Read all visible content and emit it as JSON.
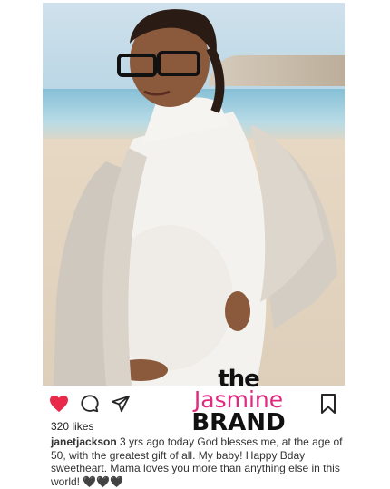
{
  "post": {
    "likes": "320 likes",
    "username": "janetjackson",
    "caption": " 3 yrs ago today God blesses me, at the age of 50, with the greatest gift of all. My baby! Happy Bday sweetheart. Mama loves you more than anything else in this world! 🖤🖤🖤"
  },
  "watermark": {
    "line1": "the",
    "line2": "Jasmine",
    "line3": "BRAND"
  },
  "icons": {
    "like": "heart-icon",
    "comment": "comment-icon",
    "share": "share-icon",
    "save": "bookmark-icon"
  },
  "colors": {
    "like": "#e8294a",
    "watermark_accent": "#e0297f"
  }
}
